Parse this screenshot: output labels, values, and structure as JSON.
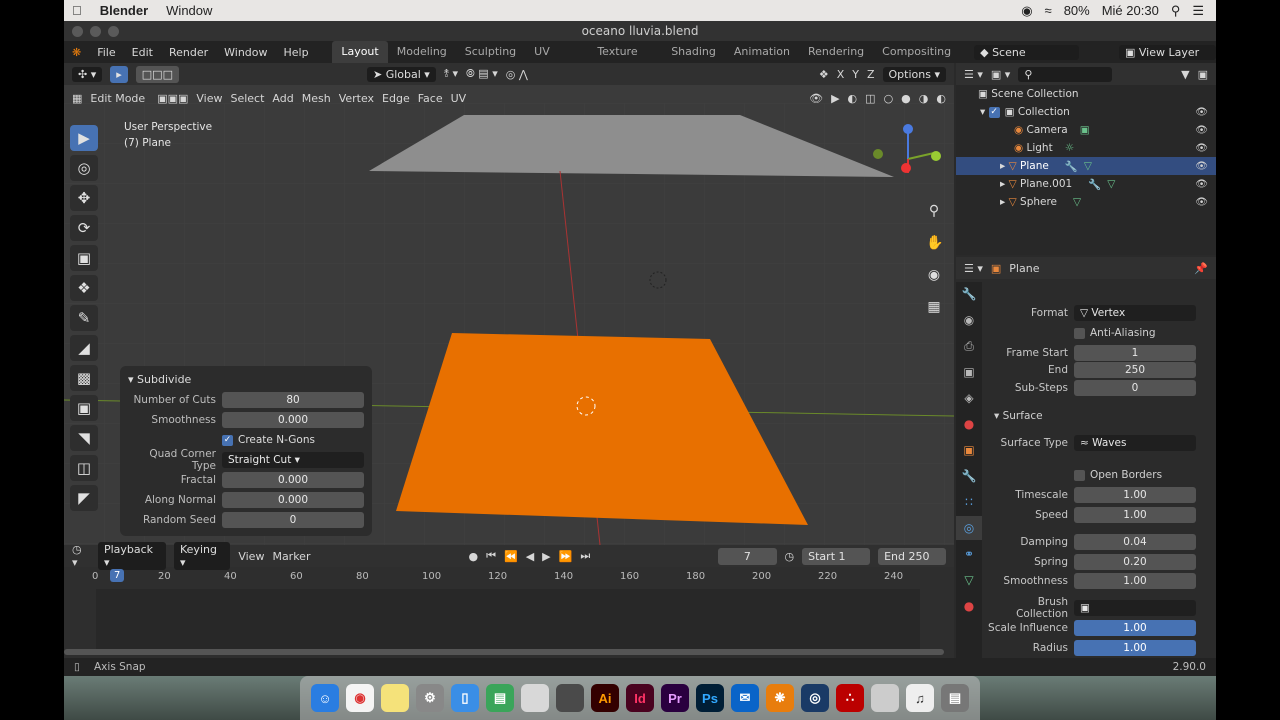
{
  "mac": {
    "app": "Blender",
    "menu": "Window",
    "battery": "80%",
    "clock": "Mié 20:30"
  },
  "window": {
    "title": "oceano lluvia.blend"
  },
  "menu": [
    "File",
    "Edit",
    "Render",
    "Window",
    "Help"
  ],
  "workspaces": [
    "Layout",
    "Modeling",
    "Sculpting",
    "UV Editing",
    "Texture Paint",
    "Shading",
    "Animation",
    "Rendering",
    "Compositing"
  ],
  "scene": "Scene",
  "view_layer": "View Layer",
  "vp_header": {
    "orientation": "Global",
    "options": "Options",
    "axes": [
      "X",
      "Y",
      "Z"
    ]
  },
  "vp_menu": {
    "mode": "Edit Mode",
    "items": [
      "View",
      "Select",
      "Add",
      "Mesh",
      "Vertex",
      "Edge",
      "Face",
      "UV"
    ]
  },
  "vp_text": {
    "persp": "User Perspective",
    "object": "(7) Plane"
  },
  "operator": {
    "title": "Subdivide",
    "rows": [
      {
        "label": "Number of Cuts",
        "value": "80"
      },
      {
        "label": "Smoothness",
        "value": "0.000"
      }
    ],
    "ngons": "Create N-Gons",
    "qct_label": "Quad Corner Type",
    "qct_value": "Straight Cut",
    "rows2": [
      {
        "label": "Fractal",
        "value": "0.000"
      },
      {
        "label": "Along Normal",
        "value": "0.000"
      },
      {
        "label": "Random Seed",
        "value": "0"
      }
    ]
  },
  "timeline": {
    "menu": [
      "Playback",
      "Keying",
      "View",
      "Marker"
    ],
    "frame": "7",
    "start_label": "Start",
    "start": "1",
    "end_label": "End",
    "end": "250",
    "ticks": [
      "0",
      "20",
      "40",
      "60",
      "80",
      "100",
      "120",
      "140",
      "160",
      "180",
      "200",
      "220",
      "240"
    ],
    "current": "7"
  },
  "outliner": {
    "root": "Scene Collection",
    "collection": "Collection",
    "items": [
      "Camera",
      "Light",
      "Plane",
      "Plane.001",
      "Sphere"
    ]
  },
  "props": {
    "object": "Plane",
    "format_label": "Format",
    "format_value": "Vertex",
    "aa": "Anti-Aliasing",
    "fs_label": "Frame Start",
    "fs": "1",
    "end_label": "End",
    "end": "250",
    "ss_label": "Sub-Steps",
    "ss": "0",
    "surface": "Surface",
    "st_label": "Surface Type",
    "st_value": "Waves",
    "ob": "Open Borders",
    "ts_label": "Timescale",
    "ts": "1.00",
    "sp_label": "Speed",
    "sp": "1.00",
    "dm_label": "Damping",
    "dm": "0.04",
    "spr_label": "Spring",
    "spr": "0.20",
    "sm_label": "Smoothness",
    "sm": "1.00",
    "bc_label": "Brush Collection",
    "si_label": "Scale Influence",
    "si": "1.00",
    "rd_label": "Radius",
    "rd": "1.00"
  },
  "status": {
    "left": "Axis Snap",
    "version": "2.90.0"
  },
  "dock": [
    "Ai",
    "Id",
    "Pr",
    "Ps"
  ]
}
